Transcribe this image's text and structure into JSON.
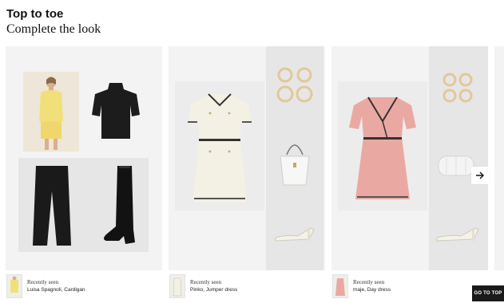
{
  "header": {
    "title": "Top to toe",
    "subtitle": "Complete the look"
  },
  "looks": [
    {
      "recent_label": "Recently seen",
      "recent_item": "Luisa Spagnoli, Cardigan"
    },
    {
      "recent_label": "Recently seen",
      "recent_item": "Pinko, Jumper dress"
    },
    {
      "recent_label": "Recently seen",
      "recent_item": "maje, Day dress"
    }
  ],
  "controls": {
    "next_icon": "arrow-right-icon",
    "go_to_top_label": "GO TO TOP"
  },
  "colors": {
    "card_background": "#f3f3f3",
    "go_top_background": "#1a1a1a",
    "yellow_blazer": "#f1e07a",
    "cream_dress": "#f3f0e4",
    "pink_dress": "#e9a9a2",
    "gold_earrings": "#e3c79a"
  }
}
